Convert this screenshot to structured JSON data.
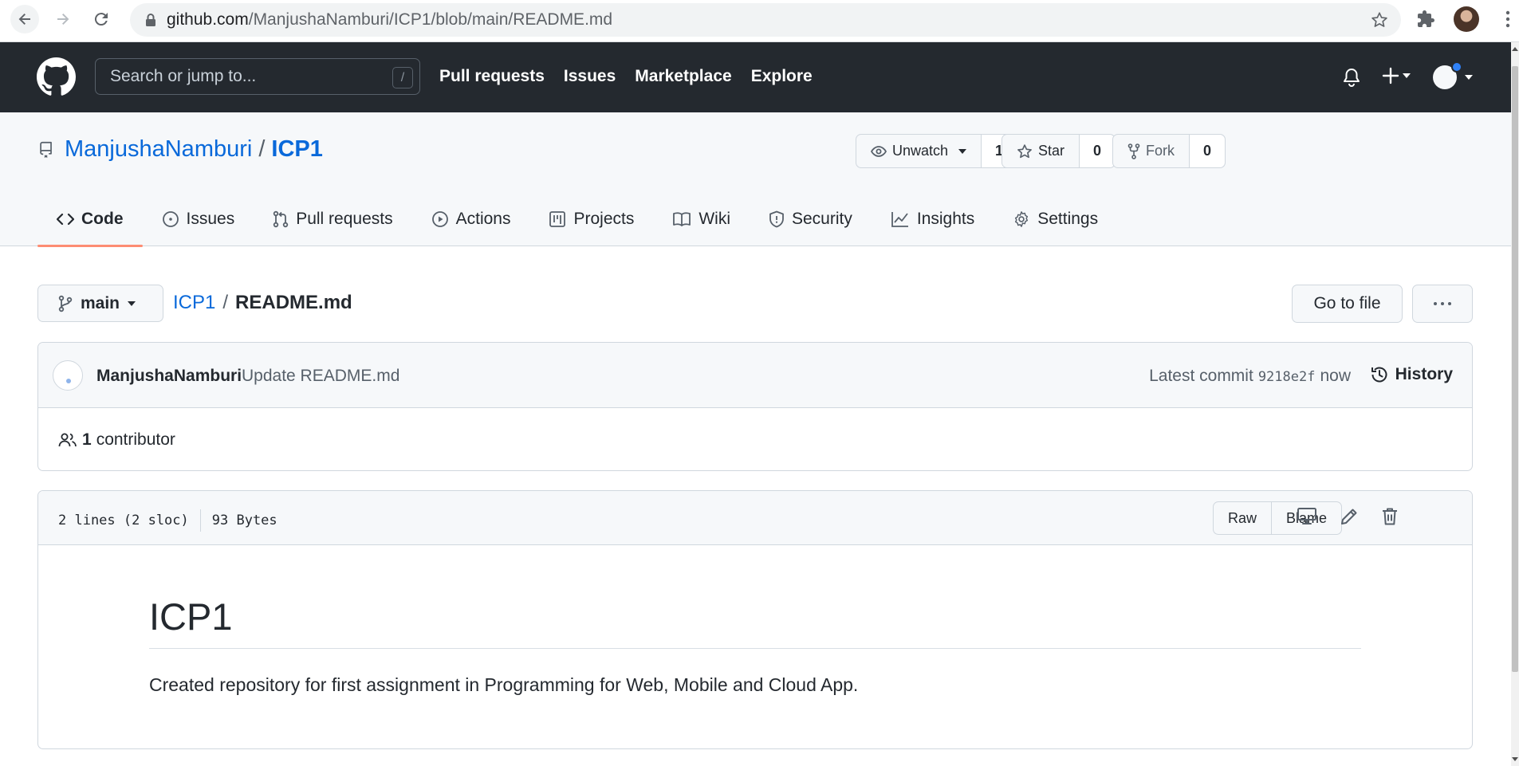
{
  "browser": {
    "url_host": "github.com",
    "url_path": "/ManjushaNamburi/ICP1/blob/main/README.md"
  },
  "header": {
    "search_placeholder": "Search or jump to...",
    "search_shortcut": "/",
    "nav": [
      "Pull requests",
      "Issues",
      "Marketplace",
      "Explore"
    ]
  },
  "repo": {
    "owner": "ManjushaNamburi",
    "separator": "/",
    "name": "ICP1",
    "watch_label": "Unwatch",
    "watch_count": "1",
    "star_label": "Star",
    "star_count": "0",
    "fork_label": "Fork",
    "fork_count": "0",
    "tabs": [
      {
        "label": "Code",
        "icon": "code-icon"
      },
      {
        "label": "Issues",
        "icon": "issue-icon"
      },
      {
        "label": "Pull requests",
        "icon": "pull-request-icon"
      },
      {
        "label": "Actions",
        "icon": "play-icon"
      },
      {
        "label": "Projects",
        "icon": "project-icon"
      },
      {
        "label": "Wiki",
        "icon": "book-icon"
      },
      {
        "label": "Security",
        "icon": "shield-icon"
      },
      {
        "label": "Insights",
        "icon": "graph-icon"
      },
      {
        "label": "Settings",
        "icon": "gear-icon"
      }
    ],
    "active_tab": "Code"
  },
  "file_nav": {
    "branch": "main",
    "crumb_repo": "ICP1",
    "crumb_sep": "/",
    "crumb_file": "README.md",
    "goto_label": "Go to file",
    "more_label": "···"
  },
  "commit": {
    "author": "ManjushaNamburi",
    "message": "Update README.md",
    "latest_label": "Latest commit",
    "sha": "9218e2f",
    "time": "now",
    "history_label": "History",
    "contributor_count": "1",
    "contributor_label": "contributor"
  },
  "file": {
    "lines": "2 lines (2 sloc)",
    "size": "93 Bytes",
    "raw_label": "Raw",
    "blame_label": "Blame",
    "readme_title": "ICP1",
    "readme_text": "Created repository for first assignment in Programming for Web, Mobile and Cloud App."
  },
  "colors": {
    "header_bg": "#24292f",
    "link": "#0969da",
    "tab_underline": "#fd8c73",
    "notification_dot": "#2f81f7"
  }
}
